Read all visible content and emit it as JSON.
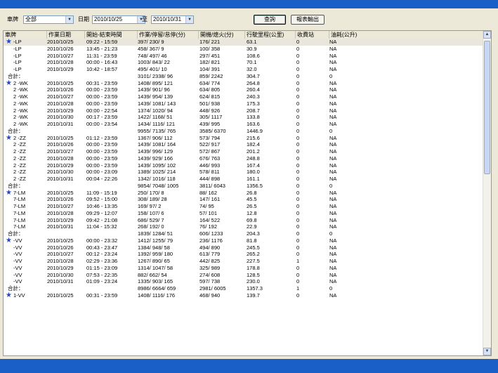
{
  "filters": {
    "plate_label": "車牌",
    "plate_value": "全部",
    "date_label": "日期",
    "start_date": "2010/10/25",
    "to_label": "至",
    "end_date": "2010/10/31"
  },
  "buttons": {
    "query": "查詢",
    "export": "報表輸出"
  },
  "columns": [
    "車牌",
    "作業日期",
    "開始-結束時間",
    "作業/停留/怠停(分)",
    "開機/熄火(分)",
    "行駛里程(公里)",
    "收費站",
    "油耗(公升)"
  ],
  "rows": [
    {
      "star": true,
      "plate": "-LP",
      "date": "2010/10/25",
      "time": "09:22 - 15:59",
      "work": "397/ 230/ 9",
      "eng": "176/ 221",
      "km": "63.1",
      "toll": "0",
      "fuel": "NA"
    },
    {
      "star": false,
      "plate": "-LP",
      "date": "2010/10/26",
      "time": "13:45 - 21:23",
      "work": "458/ 367/ 9",
      "eng": "100/ 358",
      "km": "30.9",
      "toll": "0",
      "fuel": "NA"
    },
    {
      "star": false,
      "plate": "-LP",
      "date": "2010/10/27",
      "time": "11:31 - 23:59",
      "work": "748/ 497/ 46",
      "eng": "297/ 451",
      "km": "108.6",
      "toll": "0",
      "fuel": "NA"
    },
    {
      "star": false,
      "plate": "-LP",
      "date": "2010/10/28",
      "time": "00:00 - 16:43",
      "work": "1003/ 843/ 22",
      "eng": "182/ 821",
      "km": "70.1",
      "toll": "0",
      "fuel": "NA"
    },
    {
      "star": false,
      "plate": "-LP",
      "date": "2010/10/29",
      "time": "10:42 - 18:57",
      "work": "495/ 401/ 10",
      "eng": "104/ 391",
      "km": "32.0",
      "toll": "0",
      "fuel": "NA"
    },
    {
      "star": false,
      "plate": "合計：",
      "date": "",
      "time": "",
      "work": "3101/ 2338/ 96",
      "eng": "859/ 2242",
      "km": "304.7",
      "toll": "0",
      "fuel": "0"
    },
    {
      "star": true,
      "plate": "2 -WK",
      "date": "2010/10/25",
      "time": "00:31 - 23:59",
      "work": "1408/ 895/ 121",
      "eng": "634/ 774",
      "km": "264.8",
      "toll": "0",
      "fuel": "NA"
    },
    {
      "star": false,
      "plate": "2 -WK",
      "date": "2010/10/26",
      "time": "00:00 - 23:59",
      "work": "1439/ 901/ 96",
      "eng": "634/ 805",
      "km": "260.4",
      "toll": "0",
      "fuel": "NA"
    },
    {
      "star": false,
      "plate": "2 -WK",
      "date": "2010/10/27",
      "time": "00:00 - 23:59",
      "work": "1439/ 954/ 139",
      "eng": "624/ 815",
      "km": "240.3",
      "toll": "0",
      "fuel": "NA"
    },
    {
      "star": false,
      "plate": "2 -WK",
      "date": "2010/10/28",
      "time": "00:00 - 23:59",
      "work": "1439/ 1081/ 143",
      "eng": "501/ 938",
      "km": "175.3",
      "toll": "0",
      "fuel": "NA"
    },
    {
      "star": false,
      "plate": "2 -WK",
      "date": "2010/10/29",
      "time": "00:00 - 22:54",
      "work": "1374/ 1020/ 94",
      "eng": "448/ 926",
      "km": "208.7",
      "toll": "0",
      "fuel": "NA"
    },
    {
      "star": false,
      "plate": "2 -WK",
      "date": "2010/10/30",
      "time": "00:17 - 23:59",
      "work": "1422/ 1168/ 51",
      "eng": "305/ 1117",
      "km": "133.8",
      "toll": "0",
      "fuel": "NA"
    },
    {
      "star": false,
      "plate": "2 -WK",
      "date": "2010/10/31",
      "time": "00:00 - 23:54",
      "work": "1434/ 1116/ 121",
      "eng": "439/ 995",
      "km": "163.6",
      "toll": "0",
      "fuel": "NA"
    },
    {
      "star": false,
      "plate": "合計：",
      "date": "",
      "time": "",
      "work": "9955/ 7135/ 765",
      "eng": "3585/ 6370",
      "km": "1446.9",
      "toll": "0",
      "fuel": "0"
    },
    {
      "star": true,
      "plate": "2 -ZZ",
      "date": "2010/10/25",
      "time": "01:12 - 23:59",
      "work": "1367/ 906/ 112",
      "eng": "573/ 794",
      "km": "215.6",
      "toll": "0",
      "fuel": "NA"
    },
    {
      "star": false,
      "plate": "2 -ZZ",
      "date": "2010/10/26",
      "time": "00:00 - 23:59",
      "work": "1439/ 1081/ 164",
      "eng": "522/ 917",
      "km": "182.4",
      "toll": "0",
      "fuel": "NA"
    },
    {
      "star": false,
      "plate": "2 -ZZ",
      "date": "2010/10/27",
      "time": "00:00 - 23:59",
      "work": "1439/ 996/ 129",
      "eng": "572/ 867",
      "km": "201.2",
      "toll": "0",
      "fuel": "NA"
    },
    {
      "star": false,
      "plate": "2 -ZZ",
      "date": "2010/10/28",
      "time": "00:00 - 23:59",
      "work": "1439/ 929/ 166",
      "eng": "676/ 763",
      "km": "248.8",
      "toll": "0",
      "fuel": "NA"
    },
    {
      "star": false,
      "plate": "2 -ZZ",
      "date": "2010/10/29",
      "time": "00:00 - 23:59",
      "work": "1439/ 1095/ 102",
      "eng": "446/ 993",
      "km": "167.4",
      "toll": "0",
      "fuel": "NA"
    },
    {
      "star": false,
      "plate": "2 -ZZ",
      "date": "2010/10/30",
      "time": "00:00 - 23:09",
      "work": "1389/ 1025/ 214",
      "eng": "578/ 811",
      "km": "180.0",
      "toll": "0",
      "fuel": "NA"
    },
    {
      "star": false,
      "plate": "2 -ZZ",
      "date": "2010/10/31",
      "time": "00:04 - 22:26",
      "work": "1342/ 1016/ 118",
      "eng": "444/ 898",
      "km": "161.1",
      "toll": "0",
      "fuel": "NA"
    },
    {
      "star": false,
      "plate": "合計：",
      "date": "",
      "time": "",
      "work": "9854/ 7048/ 1005",
      "eng": "3811/ 6043",
      "km": "1356.5",
      "toll": "0",
      "fuel": "0"
    },
    {
      "star": true,
      "plate": "7-LM",
      "date": "2010/10/25",
      "time": "11:09 - 15:19",
      "work": "250/ 170/ 8",
      "eng": "88/ 162",
      "km": "26.8",
      "toll": "0",
      "fuel": "NA"
    },
    {
      "star": false,
      "plate": "7-LM",
      "date": "2010/10/26",
      "time": "09:52 - 15:00",
      "work": "308/ 189/ 28",
      "eng": "147/ 161",
      "km": "45.5",
      "toll": "0",
      "fuel": "NA"
    },
    {
      "star": false,
      "plate": "7-LM",
      "date": "2010/10/27",
      "time": "10:46 - 13:35",
      "work": "169/ 97/ 2",
      "eng": "74/ 95",
      "km": "26.5",
      "toll": "0",
      "fuel": "NA"
    },
    {
      "star": false,
      "plate": "7-LM",
      "date": "2010/10/28",
      "time": "09:29 - 12:07",
      "work": "158/ 107/ 6",
      "eng": "57/ 101",
      "km": "12.8",
      "toll": "0",
      "fuel": "NA"
    },
    {
      "star": false,
      "plate": "7-LM",
      "date": "2010/10/29",
      "time": "09:42 - 21:08",
      "work": "686/ 529/ 7",
      "eng": "164/ 522",
      "km": "69.8",
      "toll": "0",
      "fuel": "NA"
    },
    {
      "star": false,
      "plate": "7-LM",
      "date": "2010/10/31",
      "time": "11:04 - 15:32",
      "work": "268/ 192/ 0",
      "eng": "76/ 192",
      "km": "22.9",
      "toll": "0",
      "fuel": "NA"
    },
    {
      "star": false,
      "plate": "合計：",
      "date": "",
      "time": "",
      "work": "1839/ 1284/ 51",
      "eng": "606/ 1233",
      "km": "204.3",
      "toll": "0",
      "fuel": "0"
    },
    {
      "star": true,
      "plate": "-VV",
      "date": "2010/10/25",
      "time": "00:00 - 23:32",
      "work": "1412/ 1255/ 79",
      "eng": "236/ 1176",
      "km": "81.8",
      "toll": "0",
      "fuel": "NA"
    },
    {
      "star": false,
      "plate": "-VV",
      "date": "2010/10/26",
      "time": "00:43 - 23:47",
      "work": "1384/ 948/ 58",
      "eng": "494/ 890",
      "km": "245.5",
      "toll": "0",
      "fuel": "NA"
    },
    {
      "star": false,
      "plate": "-VV",
      "date": "2010/10/27",
      "time": "00:12 - 23:24",
      "work": "1392/ 959/ 180",
      "eng": "613/ 779",
      "km": "265.2",
      "toll": "0",
      "fuel": "NA"
    },
    {
      "star": false,
      "plate": "-VV",
      "date": "2010/10/28",
      "time": "02:29 - 23:36",
      "work": "1267/ 890/ 65",
      "eng": "442/ 825",
      "km": "227.5",
      "toll": "1",
      "fuel": "NA"
    },
    {
      "star": false,
      "plate": "-VV",
      "date": "2010/10/29",
      "time": "01:15 - 23:09",
      "work": "1314/ 1047/ 58",
      "eng": "325/ 989",
      "km": "178.8",
      "toll": "0",
      "fuel": "NA"
    },
    {
      "star": false,
      "plate": "-VV",
      "date": "2010/10/30",
      "time": "07:53 - 22:35",
      "work": "882/ 662/ 54",
      "eng": "274/ 608",
      "km": "128.5",
      "toll": "0",
      "fuel": "NA"
    },
    {
      "star": false,
      "plate": "-VV",
      "date": "2010/10/31",
      "time": "01:09 - 23:24",
      "work": "1335/ 903/ 165",
      "eng": "597/ 738",
      "km": "230.0",
      "toll": "0",
      "fuel": "NA"
    },
    {
      "star": false,
      "plate": "合計：",
      "date": "",
      "time": "",
      "work": "8986/ 6664/ 659",
      "eng": "2981/ 6005",
      "km": "1357.3",
      "toll": "1",
      "fuel": "0"
    },
    {
      "star": true,
      "plate": "1-VV",
      "date": "2010/10/25",
      "time": "00:31 - 23:59",
      "work": "1408/ 1116/ 176",
      "eng": "468/ 940",
      "km": "139.7",
      "toll": "0",
      "fuel": "NA"
    }
  ],
  "colors": {
    "accent": "#1a5fc8",
    "panel": "#ece9d8",
    "star": "#2244cc"
  }
}
